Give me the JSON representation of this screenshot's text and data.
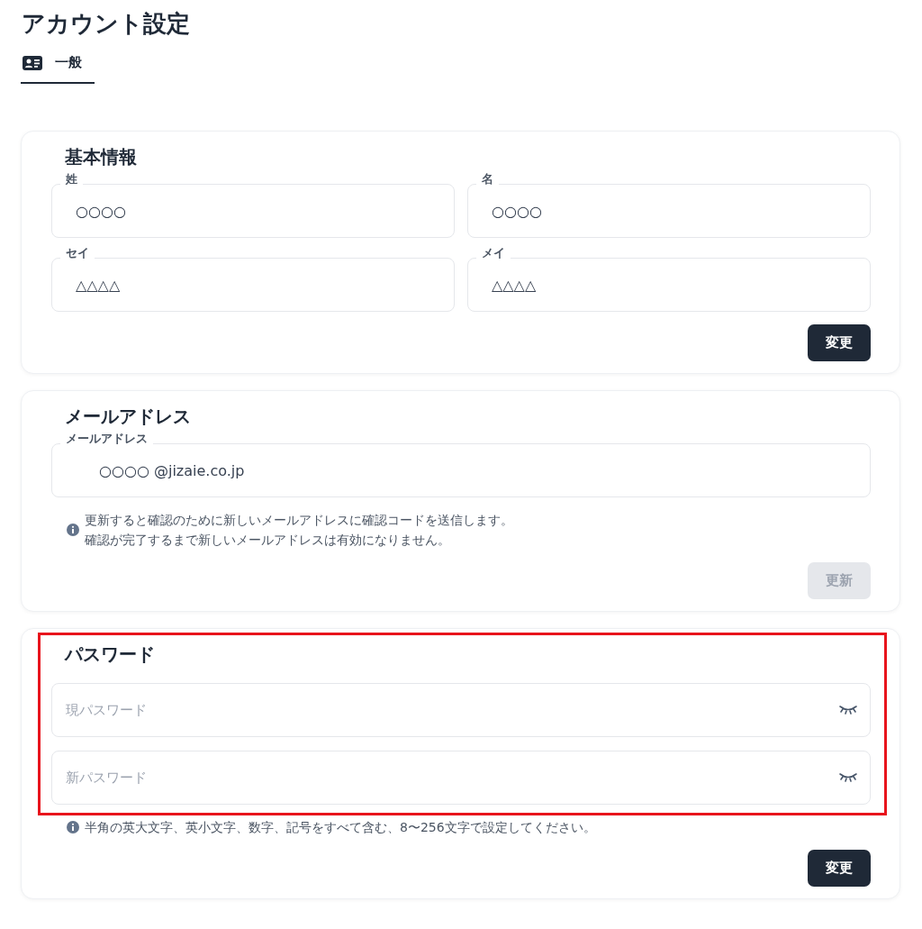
{
  "page": {
    "title": "アカウント設定"
  },
  "tabs": [
    {
      "label": "一般",
      "selected": true
    }
  ],
  "sections": [
    {
      "kind": "name",
      "heading": "基本情報",
      "highlighted": false,
      "fields": [
        {
          "label": "姓",
          "value": "○○○○"
        },
        {
          "label": "名",
          "value": "○○○○"
        },
        {
          "label": "セイ",
          "value": "△△△△"
        },
        {
          "label": "メイ",
          "value": "△△△△"
        }
      ],
      "button": {
        "label": "変更",
        "disabled": false
      }
    },
    {
      "kind": "email",
      "heading": "メールアドレス",
      "highlighted": false,
      "fields": [
        {
          "label": "メールアドレス",
          "value": "○○○○ @jizaie.co.jp"
        }
      ],
      "note": [
        "更新すると確認のために新しいメールアドレスに確認コードを送信します。",
        "確認が完了するまで新しいメールアドレスは有効になりません。"
      ],
      "button": {
        "label": "更新",
        "disabled": true
      }
    },
    {
      "kind": "password",
      "heading": "パスワード",
      "highlighted": true,
      "fields": [
        {
          "placeholder": "現パスワード"
        },
        {
          "placeholder": "新パスワード"
        }
      ],
      "note": [
        "半角の英大文字、英小文字、数字、記号をすべて含む、8〜256文字で設定してください。"
      ],
      "button": {
        "label": "変更",
        "disabled": false
      }
    }
  ]
}
